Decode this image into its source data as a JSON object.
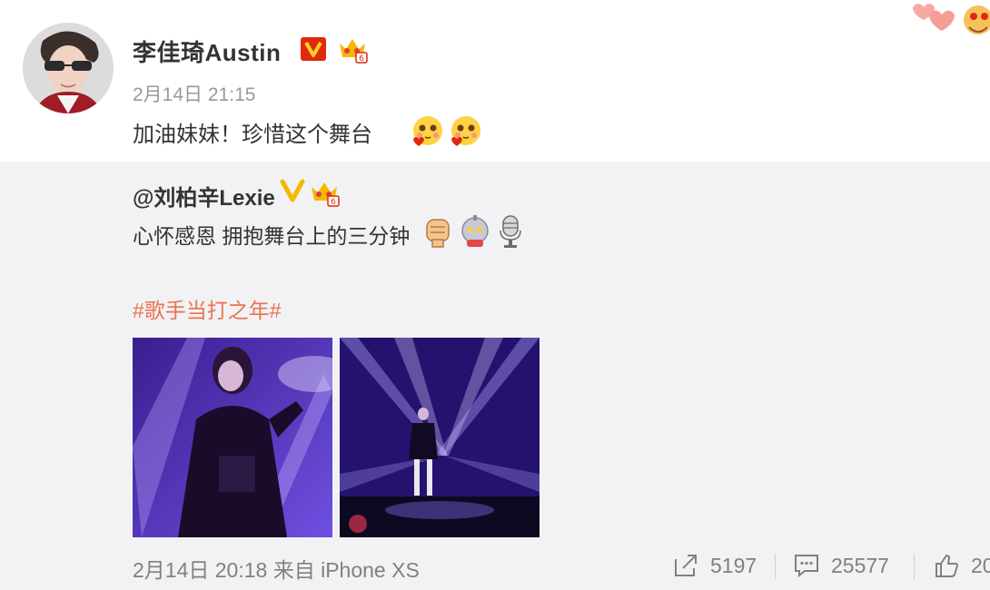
{
  "post": {
    "author": "李佳琦Austin",
    "time": "2月14日 21:15",
    "text": "加油妹妹！珍惜这个舞台",
    "text_emojis": [
      "love-face-emoji",
      "love-face-emoji"
    ]
  },
  "repost": {
    "author": "@刘柏辛Lexie",
    "text": "心怀感恩 拥抱舞台上的三分钟",
    "text_emojis": [
      "fist-emoji",
      "robot-emoji",
      "microphone-emoji"
    ],
    "topic": "#歌手当打之年#",
    "images": [
      "concert-photo-singer-closeup",
      "concert-photo-stage-wide"
    ],
    "footer_time": "2月14日 20:18 来自 iPhone XS",
    "share_count": "5197",
    "comment_count": "25577",
    "like_count": "20"
  },
  "colors": {
    "topic": "#eb7350",
    "repost_bg": "#f2f2f5",
    "muted": "#808080",
    "verified_red": "#e0290e",
    "verified_gold": "#f5b800"
  }
}
